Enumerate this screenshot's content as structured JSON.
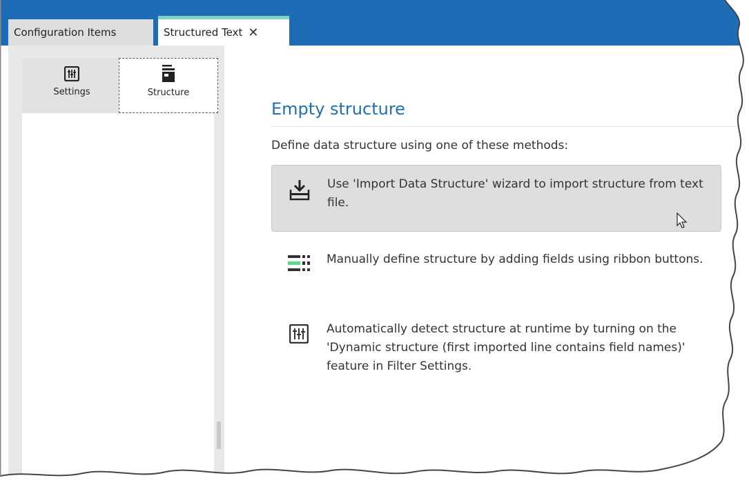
{
  "tabs": {
    "config_label": "Configuration Items",
    "structured_label": "Structured Text",
    "close_glyph": "✕"
  },
  "side_tabs": {
    "settings_label": "Settings",
    "structure_label": "Structure"
  },
  "main": {
    "heading": "Empty structure",
    "intro": "Define data structure using one of these methods:",
    "methods": [
      {
        "icon": "import-icon",
        "text": "Use 'Import Data Structure' wizard to import structure from text file."
      },
      {
        "icon": "fields-icon",
        "text": "Manually define structure by adding fields using ribbon buttons."
      },
      {
        "icon": "settings-icon",
        "text": "Automatically detect structure at runtime by turning on the 'Dynamic structure (first imported line contains field names)' feature in Filter Settings."
      }
    ]
  },
  "colors": {
    "tabbar": "#1e6cb5",
    "accent": "#1f6fb3",
    "active_tab_stripe": "#7fd3c2",
    "fields_icon_green": "#5bd88a"
  }
}
